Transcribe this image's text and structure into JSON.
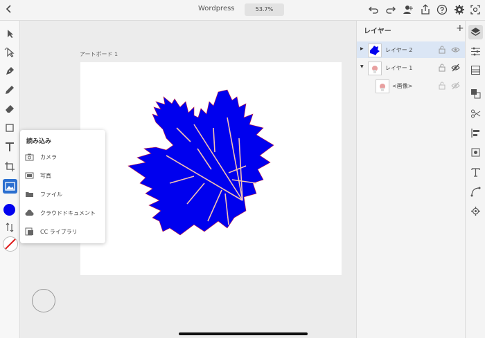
{
  "header": {
    "title": "Wordpress",
    "zoom": "53.7%"
  },
  "artboard": {
    "label": "アートボード 1"
  },
  "colors": {
    "fill": "#0000ee",
    "accent": "#2b6fd0",
    "stroke_none": "#e02020",
    "vein": "#f4c2b0"
  },
  "import_menu": {
    "title": "読み込み",
    "items": [
      {
        "label": "カメラ",
        "icon": "camera-icon"
      },
      {
        "label": "写真",
        "icon": "photo-icon"
      },
      {
        "label": "ファイル",
        "icon": "folder-icon"
      },
      {
        "label": "クラウドドキュメント",
        "icon": "cloud-icon"
      },
      {
        "label": "CC ライブラリ",
        "icon": "library-icon"
      }
    ]
  },
  "layers_panel": {
    "title": "レイヤー",
    "layers": [
      {
        "name": "レイヤー 2",
        "selected": true,
        "expanded": false
      },
      {
        "name": "レイヤー 1",
        "selected": false,
        "expanded": true
      },
      {
        "name": "<画像>",
        "selected": false,
        "child": true
      }
    ]
  }
}
